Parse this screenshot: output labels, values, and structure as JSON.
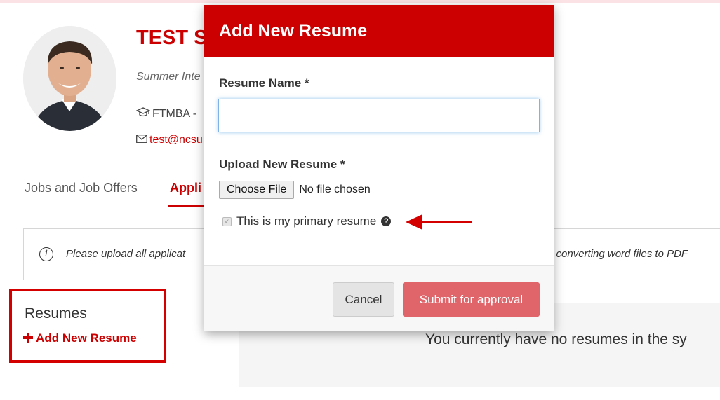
{
  "profile": {
    "name": "TEST ST",
    "subtitle": "Summer Inte",
    "program": "FTMBA -",
    "email": "test@ncsu"
  },
  "tabs": [
    {
      "label": "Jobs and Job Offers"
    },
    {
      "label": "Appli"
    }
  ],
  "alert": {
    "text_left": "Please upload all applicat",
    "text_right": "or converting word files to PDF"
  },
  "resumes": {
    "title": "Resumes",
    "add_label": "Add New Resume",
    "empty_message": "You currently have no resumes in the sy"
  },
  "modal": {
    "title": "Add New Resume",
    "name_label": "Resume Name *",
    "name_value": "",
    "upload_label": "Upload New Resume *",
    "choose_file": "Choose File",
    "no_file": "No file chosen",
    "primary_label": "This is my primary resume",
    "primary_checked": true,
    "cancel": "Cancel",
    "submit": "Submit for approval"
  },
  "colors": {
    "brand_red": "#cc0000",
    "submit_button": "#e0656b",
    "annotation_red": "#d40000"
  },
  "icons": [
    "graduation-cap-icon",
    "envelope-icon",
    "info-icon",
    "plus-icon",
    "question-circle-icon",
    "annotation-arrow-icon"
  ]
}
